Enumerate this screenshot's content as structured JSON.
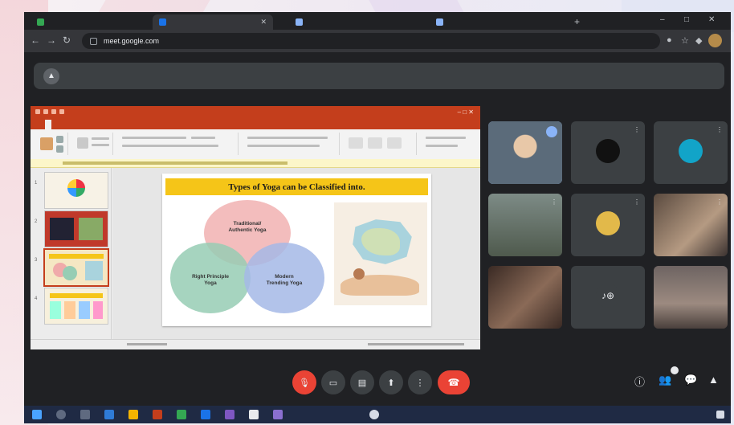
{
  "browser": {
    "tabs": [
      {
        "title": "",
        "color": "#34a853"
      },
      {
        "title": "",
        "color": "#1a73e8"
      },
      {
        "title": "",
        "color": "#8ab4f8"
      },
      {
        "title": "",
        "color": "#8ab4f8"
      }
    ],
    "new_tab": "+",
    "window_controls": [
      "–",
      "□",
      "✕"
    ],
    "address": {
      "url": "meet.google.com",
      "rest": ""
    },
    "nav_icons": [
      "back-icon",
      "forward-icon",
      "reload-icon"
    ]
  },
  "banner": {
    "text": "",
    "icon": "present-icon"
  },
  "slide": {
    "title": "Types of Yoga can be Classified into.",
    "venn": [
      {
        "label": "Traditional/ Authentic Yoga",
        "color": "#f0aaaa"
      },
      {
        "label": "Right Principle Yoga",
        "color": "#96cdb4"
      },
      {
        "label": "Modern Trending Yoga",
        "color": "#a5b9e6"
      }
    ],
    "thumbnails": [
      {
        "num": "1",
        "bg": "#f7f2e6"
      },
      {
        "num": "2",
        "bg": "#c0392b"
      },
      {
        "num": "3",
        "bg": "#f5e7c3"
      },
      {
        "num": "4",
        "bg": "#f7f0dc"
      }
    ]
  },
  "participants": [
    {
      "name": "",
      "type": "camera",
      "bg": "#5b6b7a",
      "speaking": true
    },
    {
      "name": "",
      "type": "avatar",
      "avatar_color": "#111111"
    },
    {
      "name": "",
      "type": "avatar",
      "avatar_color": "#12a4c8"
    },
    {
      "name": "",
      "type": "camera",
      "bg": "#6a7a6d"
    },
    {
      "name": "",
      "type": "avatar",
      "avatar_color": "#e2b94a"
    },
    {
      "name": "",
      "type": "camera",
      "bg": "#8d7a69"
    },
    {
      "name": "",
      "type": "camera",
      "bg": "#6d5244"
    },
    {
      "name": "",
      "type": "others"
    },
    {
      "name": "",
      "type": "camera",
      "bg": "#7a6b68"
    }
  ],
  "meeting": {
    "info": "",
    "participant_count": ""
  },
  "controls": [
    {
      "name": "mic-off-button",
      "glyph": "🎙",
      "red": true
    },
    {
      "name": "camera-button",
      "glyph": "▭",
      "red": false
    },
    {
      "name": "captions-button",
      "glyph": "▤",
      "red": false
    },
    {
      "name": "present-button",
      "glyph": "⬆",
      "red": false
    },
    {
      "name": "more-options-button",
      "glyph": "⋮",
      "red": false
    }
  ],
  "end_call": "☎",
  "right_controls": [
    "ⓘ",
    "👥",
    "💬",
    "▲"
  ],
  "taskbar": {
    "tray": "",
    "time": ""
  }
}
